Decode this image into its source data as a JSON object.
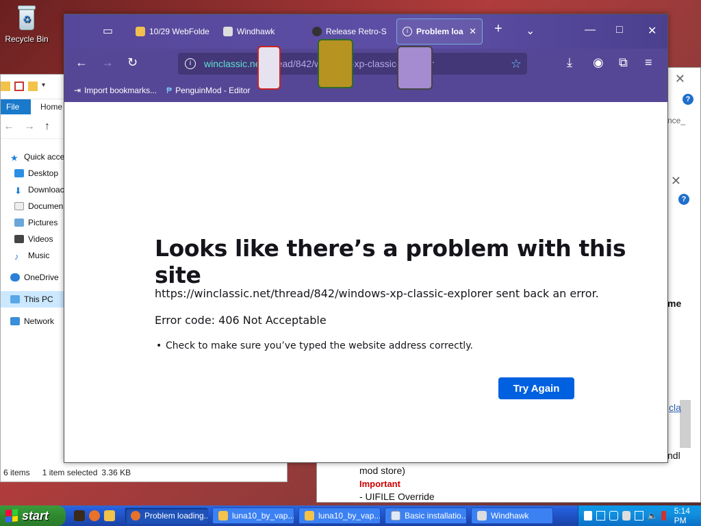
{
  "desktop": {
    "recycle_bin_label": "Recycle Bin"
  },
  "explorer": {
    "ribbon_file": "File",
    "ribbon_home": "Home",
    "tree": [
      {
        "label": "Quick acce",
        "icon": "star-icon",
        "level": 1
      },
      {
        "label": "Desktop",
        "icon": "desktop-folder-icon",
        "level": 2
      },
      {
        "label": "Downloac",
        "icon": "download-folder-icon",
        "level": 2
      },
      {
        "label": "Documen",
        "icon": "documents-folder-icon",
        "level": 2
      },
      {
        "label": "Pictures",
        "icon": "pictures-folder-icon",
        "level": 2
      },
      {
        "label": "Videos",
        "icon": "videos-folder-icon",
        "level": 2
      },
      {
        "label": "Music",
        "icon": "music-folder-icon",
        "level": 2
      },
      {
        "label": "OneDrive",
        "icon": "cloud-icon",
        "level": 1
      },
      {
        "label": "This PC",
        "icon": "pc-icon",
        "level": 1,
        "selected": true
      },
      {
        "label": "Network",
        "icon": "network-icon",
        "level": 1
      }
    ],
    "status_items": "6 items",
    "status_selected": "1 item selected",
    "status_size": "3.36 KB"
  },
  "right_window": {
    "line_mod_store": "mod store)",
    "line_important": "Important",
    "line_uefi": "- UIFILE Override",
    "partial_link": "cla",
    "partial_me": "me",
    "partial_ndl": "ndl",
    "partial_nce": "nce_"
  },
  "firefox": {
    "tabs": [
      {
        "label": "10/29 WebFolde",
        "icon": "folder-favicon"
      },
      {
        "label": "Windhawk",
        "icon": "windhawk-favicon"
      },
      {
        "label": "Release Retro-S",
        "icon": "github-favicon"
      },
      {
        "label": "Problem loa",
        "icon": "info-icon",
        "active": true
      }
    ],
    "url_host": "winclassic.net",
    "url_path": "/thread/842/windows-xp-classic-explorer",
    "bookmarks": [
      {
        "label": "Import bookmarks...",
        "icon": "import-icon"
      },
      {
        "label": "PenguinMod - Editor",
        "icon": "penguinmod-favicon"
      }
    ],
    "error": {
      "title": "Looks like there’s a problem with this site",
      "message": "https://winclassic.net/thread/842/windows-xp-classic-explorer sent back an error.",
      "code": "Error code: 406 Not Acceptable",
      "bullet": "Check to make sure you’ve typed the website address correctly.",
      "button": "Try Again"
    }
  },
  "taskbar": {
    "start_label": "start",
    "tasks": [
      {
        "label": "Problem loading...",
        "icon": "firefox-icon",
        "active": true
      },
      {
        "label": "luna10_by_vap...",
        "icon": "folder-icon"
      },
      {
        "label": "luna10_by_vap...",
        "icon": "folder-icon"
      },
      {
        "label": "Basic installatio...",
        "icon": "document-icon"
      },
      {
        "label": "Windhawk",
        "icon": "windhawk-icon"
      }
    ],
    "clock": "5:14 PM"
  },
  "colors": {
    "firefox_chrome": "#564796",
    "url_host": "#5fe0d0",
    "try_again": "#0061e0",
    "xp_taskbar": "#245edb",
    "start_green": "#2f8a2f"
  }
}
